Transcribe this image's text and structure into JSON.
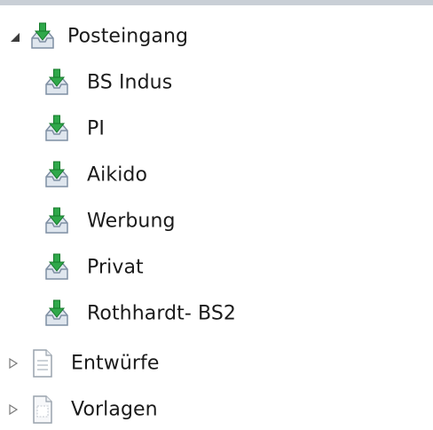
{
  "folder_tree": {
    "inbox": {
      "label": "Posteingang",
      "icon": "inbox-download-icon",
      "expanded": true,
      "subfolders": [
        {
          "label": "BS Indus",
          "icon": "inbox-download-icon"
        },
        {
          "label": "PI",
          "icon": "inbox-download-icon"
        },
        {
          "label": "Aikido",
          "icon": "inbox-download-icon"
        },
        {
          "label": "Werbung",
          "icon": "inbox-download-icon"
        },
        {
          "label": "Privat",
          "icon": "inbox-download-icon"
        },
        {
          "label": "Rothhardt- BS2",
          "icon": "inbox-download-icon"
        }
      ]
    },
    "drafts": {
      "label": "Entwürfe",
      "icon": "drafts-document-icon",
      "expanded": false
    },
    "templates": {
      "label": "Vorlagen",
      "icon": "templates-document-icon",
      "expanded": false
    }
  },
  "colors": {
    "arrow_green": "#2fa84a",
    "arrow_green_dark": "#167a2b",
    "tray_fill": "#dfe6ee",
    "tray_stroke": "#7f8fa3",
    "text": "#1b1b1b"
  }
}
